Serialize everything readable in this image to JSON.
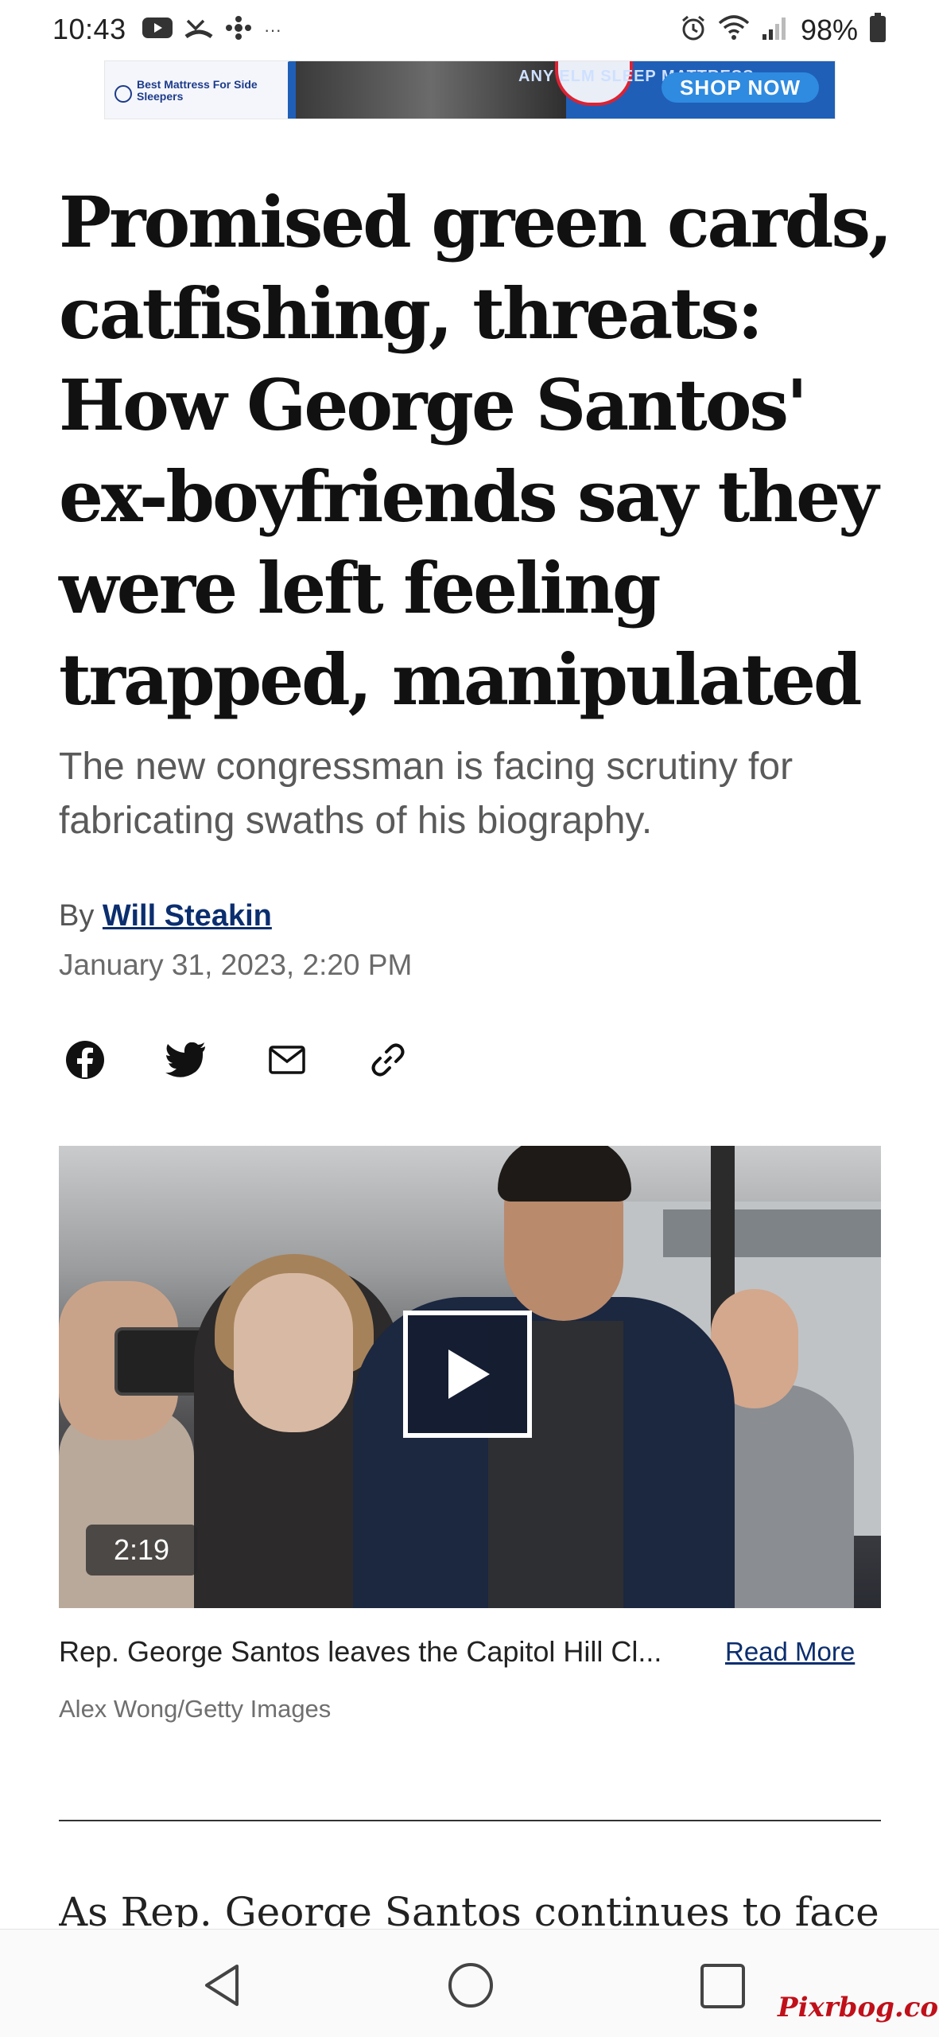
{
  "status_bar": {
    "time": "10:43",
    "overflow": "···",
    "battery": "98%",
    "icons": [
      "youtube-icon",
      "missed-call-icon",
      "network-icon",
      "alarm-icon",
      "wifi-icon",
      "signal-icon",
      "battery-icon"
    ]
  },
  "ad": {
    "left_text": "Best Mattress For Side Sleepers",
    "middle_text": "ANY ELM SLEEP MATTRESS",
    "cta": "SHOP NOW",
    "colors": {
      "brand_blue": "#1f5fb8",
      "button": "#2f8be0"
    }
  },
  "article": {
    "headline": "Promised green cards, catfishing, threats: How George Santos' ex-boyfriends say they were left feeling trapped, manipulated",
    "subheadline": "The new congressman is facing scrutiny for fabricating swaths of his biography.",
    "byline_prefix": "By",
    "author": "Will Steakin",
    "date": "January 31, 2023, 2:20 PM",
    "share_icons": [
      "facebook-icon",
      "twitter-icon",
      "email-icon",
      "link-icon"
    ],
    "video": {
      "duration": "2:19",
      "caption": "Rep. George Santos leaves the Capitol Hill Cl...",
      "read_more": "Read More",
      "credit": "Alex Wong/Getty Images"
    },
    "body_first_line": "As Rep. George Santos continues to face"
  },
  "nav_bar": {
    "buttons": [
      "back-icon",
      "home-icon",
      "recent-apps-icon"
    ]
  },
  "watermark": "Pixrbog.com",
  "colors": {
    "link": "#0b2e6f",
    "headline": "#111111",
    "subhead": "#5a5a5a"
  }
}
